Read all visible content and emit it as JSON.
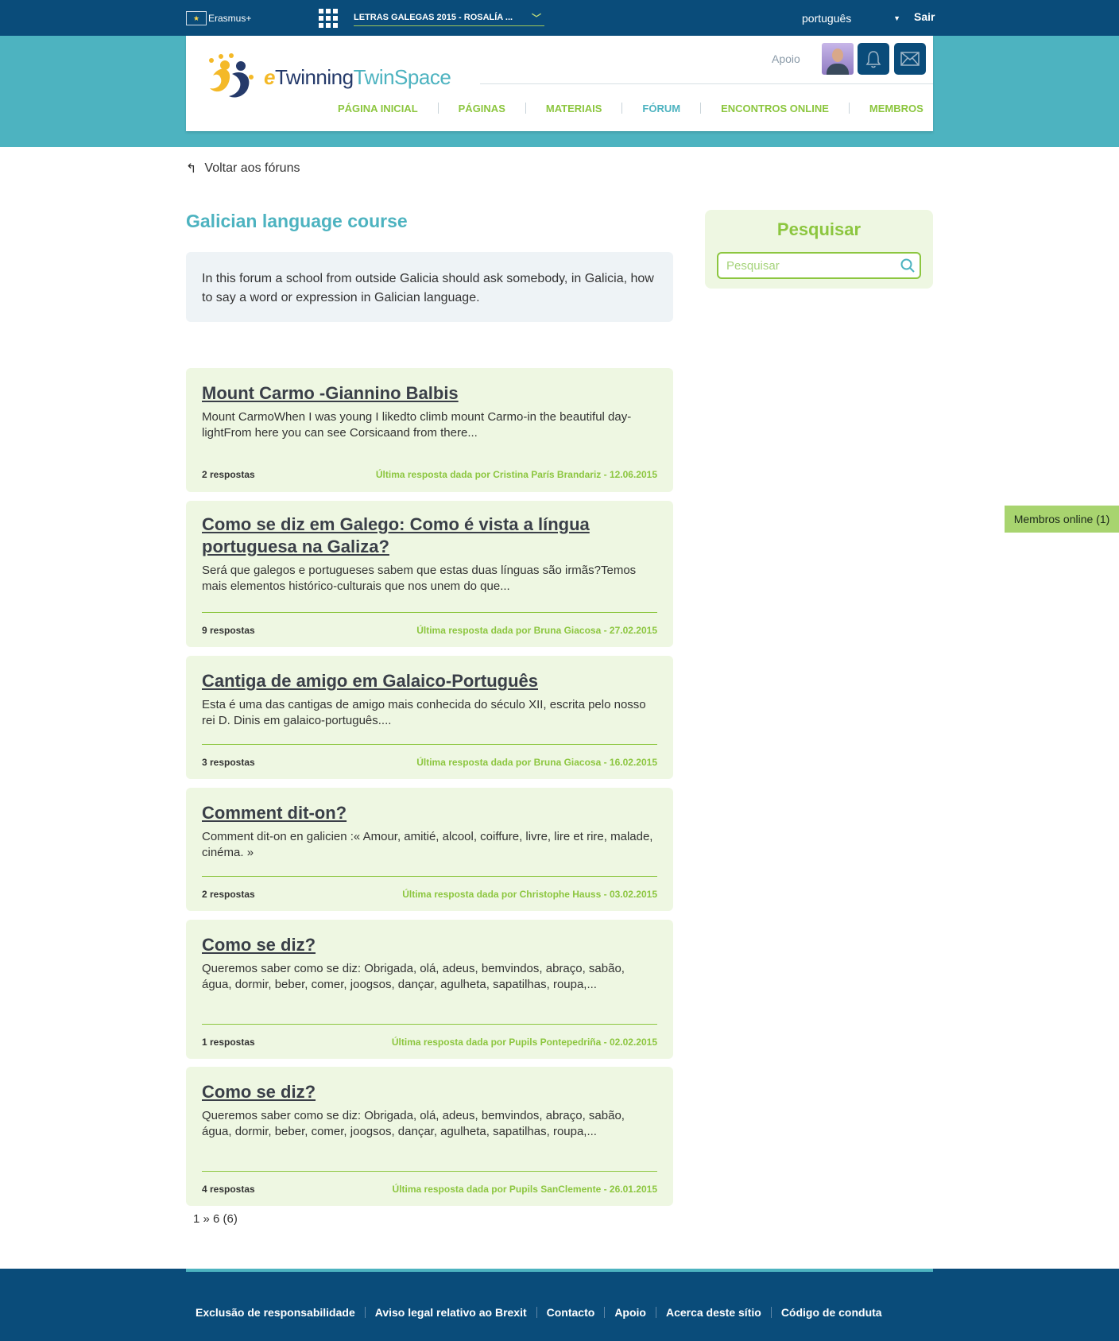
{
  "topbar": {
    "erasmus_label": "Erasmus+",
    "project_label": "LETRAS GALEGAS 2015 - ROSALÍA ...",
    "language": "português",
    "logout_label": "Sair"
  },
  "header": {
    "logo_e": "e",
    "logo_twinning": "Twinning",
    "logo_twinspace": "TwinSpace",
    "support_label": "Apoio",
    "nav": [
      {
        "label": "PÁGINA INICIAL"
      },
      {
        "label": "PÁGINAS"
      },
      {
        "label": "MATERIAIS"
      },
      {
        "label": "FÓRUM"
      },
      {
        "label": "ENCONTROS ONLINE"
      },
      {
        "label": "MEMBROS"
      }
    ]
  },
  "back_label": "Voltar aos fóruns",
  "forum": {
    "title": "Galician language course",
    "description": "In this forum a school from outside Galicia should ask somebody, in Galicia, how to say a word or expression in Galician language."
  },
  "search": {
    "title": "Pesquisar",
    "placeholder": "Pesquisar"
  },
  "threads": [
    {
      "title": "Mount Carmo -Giannino Balbis",
      "excerpt": "Mount CarmoWhen I was young I likedto climb mount Carmo-in the beautiful day-lightFrom here you can see Corsicaand from there...",
      "replies": "2 respostas",
      "last_reply": "Última resposta dada por Cristina París Brandariz - 12.06.2015"
    },
    {
      "title": "Como se diz em Galego: Como é vista a língua portuguesa na Galiza?",
      "excerpt": "Será que galegos e portugueses sabem que estas duas línguas são irmãs?Temos mais elementos histórico-culturais que nos unem do que...",
      "replies": "9 respostas",
      "last_reply": "Última resposta dada por Bruna Giacosa - 27.02.2015"
    },
    {
      "title": "Cantiga de amigo em Galaico-Português",
      "excerpt": "Esta é uma das cantigas de amigo mais conhecida do século XII, escrita pelo nosso rei D. Dinis em galaico-português....",
      "replies": "3 respostas",
      "last_reply": "Última resposta dada por Bruna Giacosa - 16.02.2015"
    },
    {
      "title": "Comment dit-on?",
      "excerpt": "Comment dit-on en galicien :« Amour, amitié, alcool, coiffure, livre, lire et rire, malade, cinéma. »",
      "replies": "2 respostas",
      "last_reply": "Última resposta dada por Christophe Hauss - 03.02.2015"
    },
    {
      "title": "Como se diz?",
      "excerpt": "Queremos saber como se diz: Obrigada, olá, adeus, bemvindos, abraço, sabão, água, dormir, beber, comer, joogsos, dançar, agulheta, sapatilhas, roupa,...",
      "replies": "1 respostas",
      "last_reply": "Última resposta dada por Pupils Pontepedriña - 02.02.2015"
    },
    {
      "title": "Como se diz?",
      "excerpt": "Queremos saber como se diz: Obrigada, olá, adeus, bemvindos, abraço, sabão, água, dormir, beber, comer, joogsos, dançar, agulheta, sapatilhas, roupa,...",
      "replies": "4 respostas",
      "last_reply": "Última resposta dada por Pupils SanClemente - 26.01.2015"
    }
  ],
  "pagination": "1 » 6 (6)",
  "members_online": "Membros online (1)",
  "footer": {
    "links": [
      {
        "label": "Exclusão de responsabilidade"
      },
      {
        "label": "Aviso legal relativo ao Brexit"
      },
      {
        "label": "Contacto"
      },
      {
        "label": "Apoio"
      },
      {
        "label": "Acerca deste sítio"
      },
      {
        "label": "Código de conduta"
      }
    ]
  },
  "colors": {
    "navy": "#0a4c7a",
    "teal": "#4db3c0",
    "green": "#8cc63f",
    "thread_bg": "#eef7e2"
  }
}
